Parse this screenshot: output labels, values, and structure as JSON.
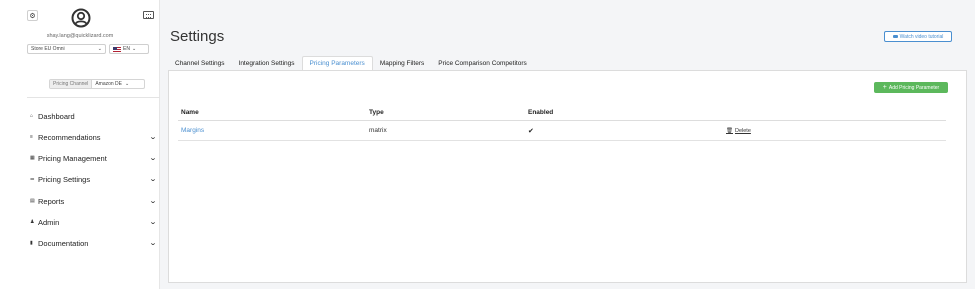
{
  "sidebar": {
    "email": "shay.lang@quicklizard.com",
    "store_select": "Store EU Omni",
    "lang_select": "EN",
    "pricing_channel_label": "Pricing Channel",
    "pricing_channel_value": "Amazon DE",
    "nav": [
      {
        "label": "Dashboard",
        "icon": "home-icon"
      },
      {
        "label": "Recommendations",
        "icon": "list-icon"
      },
      {
        "label": "Pricing Management",
        "icon": "grid-icon"
      },
      {
        "label": "Pricing Settings",
        "icon": "sliders-icon"
      },
      {
        "label": "Reports",
        "icon": "report-icon"
      },
      {
        "label": "Admin",
        "icon": "user-icon"
      },
      {
        "label": "Documentation",
        "icon": "book-icon"
      }
    ]
  },
  "main": {
    "title": "Settings",
    "tutorial_label": "Watch video tutorial",
    "tabs": [
      {
        "label": "Channel Settings"
      },
      {
        "label": "Integration Settings"
      },
      {
        "label": "Pricing Parameters",
        "active": true
      },
      {
        "label": "Mapping Filters"
      },
      {
        "label": "Price Comparison Competitors"
      }
    ],
    "add_button_label": "Add Pricing Parameter",
    "table": {
      "headers": {
        "name": "Name",
        "type": "Type",
        "enabled": "Enabled"
      },
      "rows": [
        {
          "name": "Margins",
          "type": "matrix",
          "enabled": "✔",
          "action": "Delete"
        }
      ]
    }
  },
  "colors": {
    "accent": "#4a8fd0",
    "add_button": "#5cb85c"
  }
}
